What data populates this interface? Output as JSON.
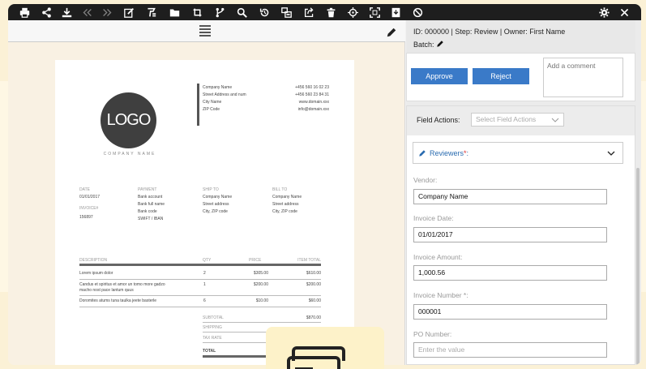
{
  "toolbar": {
    "icons": [
      "print-icon",
      "share-icon",
      "download-icon",
      "double-chevron-left-icon",
      "double-chevron-right-icon",
      "edit-icon",
      "format-icon",
      "folder-icon",
      "rotate-icon",
      "branch-icon",
      "search-icon",
      "undo-icon",
      "split-icon",
      "export-icon",
      "trash-icon",
      "crosshair-icon",
      "fullscreen-icon",
      "archive-icon",
      "block-icon",
      "gear-icon",
      "close-icon"
    ]
  },
  "document": {
    "logo_text": "LOGO",
    "company_caption": "COMPANY NAME",
    "header_left": [
      "Company Name",
      "Street Address and num",
      "City Name",
      "ZIP Code"
    ],
    "header_right": [
      "+456 560 16 02 23",
      "+456 560 23 84 31",
      "www.domain.xxx",
      "info@domain.xxx"
    ],
    "date_label": "DATE",
    "date_value": "01/01/2017",
    "invoice_label": "INVOICE#",
    "invoice_value": "156897",
    "payment_label": "PAYMENT",
    "payment_lines": [
      "Bank account",
      "Bank full name",
      "Bank code",
      "SWIFT / IBAN"
    ],
    "ship_label": "SHIP TO",
    "ship_lines": [
      "Company Name",
      "Street address",
      "City, ZIP code"
    ],
    "bill_label": "BILL TO",
    "bill_lines": [
      "Company Name",
      "Street address",
      "City, ZIP code"
    ],
    "col_desc": "DESCRIPTION",
    "col_qty": "QTY",
    "col_price": "PRICE",
    "col_total": "ITEM TOTAL",
    "rows": [
      {
        "desc": "Lorem ipsum dolor",
        "desc2": "",
        "qty": "2",
        "price": "$305.00",
        "total": "$610.00"
      },
      {
        "desc": "Candus et spiritus et amor un tomo more gadzo",
        "desc2": "macho nost pace lantum quus",
        "qty": "1",
        "price": "$200.00",
        "total": "$200.00"
      },
      {
        "desc": "Doromites atums tuna taulka jeete basterle",
        "desc2": "",
        "qty": "6",
        "price": "$10.00",
        "total": "$60.00"
      }
    ],
    "subtotal_label": "SUBTOTAL",
    "subtotal_value": "$870.00",
    "shipping_label": "SHIPPING",
    "tax_label": "TAX RATE",
    "total_label": "TOTAL"
  },
  "panel": {
    "info_line1": "ID: 000000 | Step: Review | Owner: First Name",
    "batch_label": "Batch:",
    "approve_label": "Approve",
    "reject_label": "Reject",
    "comment_placeholder": "Add a comment",
    "field_actions_label": "Field Actions:",
    "field_actions_placeholder": "Select Field Actions",
    "reviewers_label": "Reviewers",
    "reviewers_suffix": ":",
    "required_mark": "*",
    "fields": [
      {
        "label": "Vendor:",
        "value": "Company Name",
        "placeholder": ""
      },
      {
        "label": "Invoice Date:",
        "value": "01/01/2017",
        "placeholder": ""
      },
      {
        "label": "Invoice Amount:",
        "value": "1,000.56",
        "placeholder": ""
      },
      {
        "label": "Invoice Number *:",
        "value": "000001",
        "placeholder": ""
      },
      {
        "label": "PO Number:",
        "value": "",
        "placeholder": "Enter the value"
      }
    ]
  },
  "colors": {
    "accent": "#3a7ac8",
    "toolbar": "#1e1e1e",
    "background": "#fbf1d6"
  }
}
